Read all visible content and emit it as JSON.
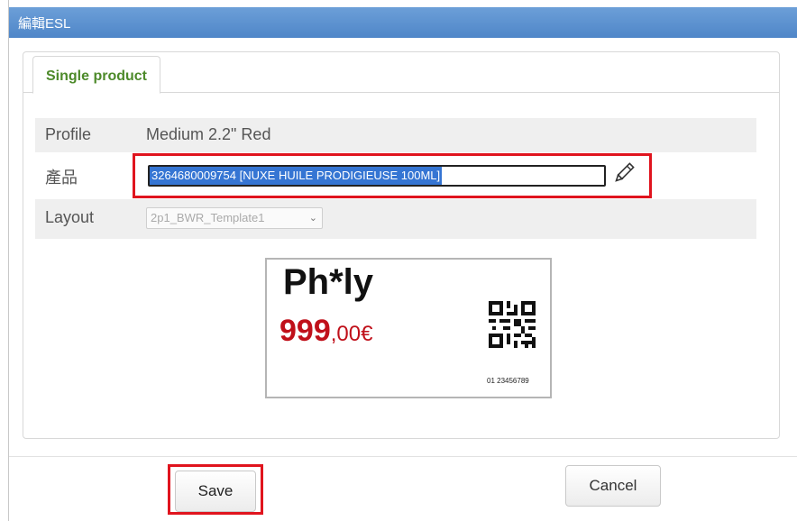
{
  "dialog": {
    "title": "編輯ESL"
  },
  "tabs": [
    {
      "label": "Single product",
      "active": true
    }
  ],
  "form": {
    "profile": {
      "label": "Profile",
      "value": "Medium 2.2\" Red"
    },
    "product": {
      "label": "產品",
      "value": "3264680009754 [NUXE HUILE PRODIGIEUSE 100ML]"
    },
    "layout": {
      "label": "Layout",
      "selected": "2p1_BWR_Template1"
    }
  },
  "preview": {
    "brand": "Ph*ly",
    "price_int": "999",
    "price_dec": ",00€",
    "barcode_number": "01 23456789"
  },
  "buttons": {
    "save": "Save",
    "cancel": "Cancel"
  },
  "icons": {
    "edit": "pencil-icon",
    "dropdown": "chevron-down-icon",
    "qr": "qr-code"
  },
  "colors": {
    "titlebar": "#5b8fd0",
    "tab_text": "#4d8a2a",
    "highlight": "#e0141e",
    "selection": "#3575d3",
    "price": "#c0101a"
  }
}
